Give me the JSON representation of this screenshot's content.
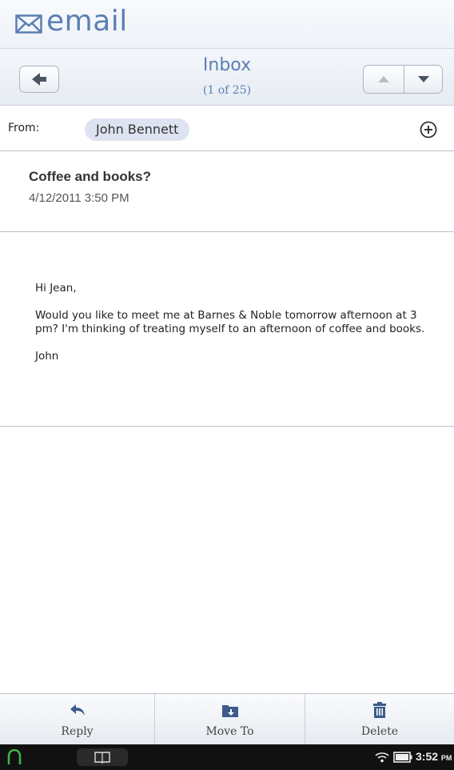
{
  "app": {
    "title": "email"
  },
  "nav": {
    "title": "Inbox",
    "count": "(1 of 25)"
  },
  "message": {
    "from_label": "From:",
    "from_name": "John Bennett",
    "subject": "Coffee and books?",
    "date": "4/12/2011 3:50 PM",
    "body": [
      "Hi Jean,",
      "Would you like to meet me at Barnes & Noble tomorrow afternoon at 3 pm? I'm thinking of treating myself to an afternoon of coffee and books.",
      "John"
    ]
  },
  "toolbar": {
    "reply": "Reply",
    "move_to": "Move To",
    "delete": "Delete"
  },
  "system": {
    "time": "3:52",
    "ampm": "PM"
  },
  "colors": {
    "accent": "#5b7fb3",
    "chip": "#dee3f1"
  },
  "icons": [
    "mail-icon",
    "back-arrow-icon",
    "up-arrow-icon",
    "down-arrow-icon",
    "add-contact-icon",
    "reply-icon",
    "move-to-folder-icon",
    "trash-icon",
    "home-icon",
    "library-icon",
    "wifi-icon",
    "battery-icon"
  ]
}
